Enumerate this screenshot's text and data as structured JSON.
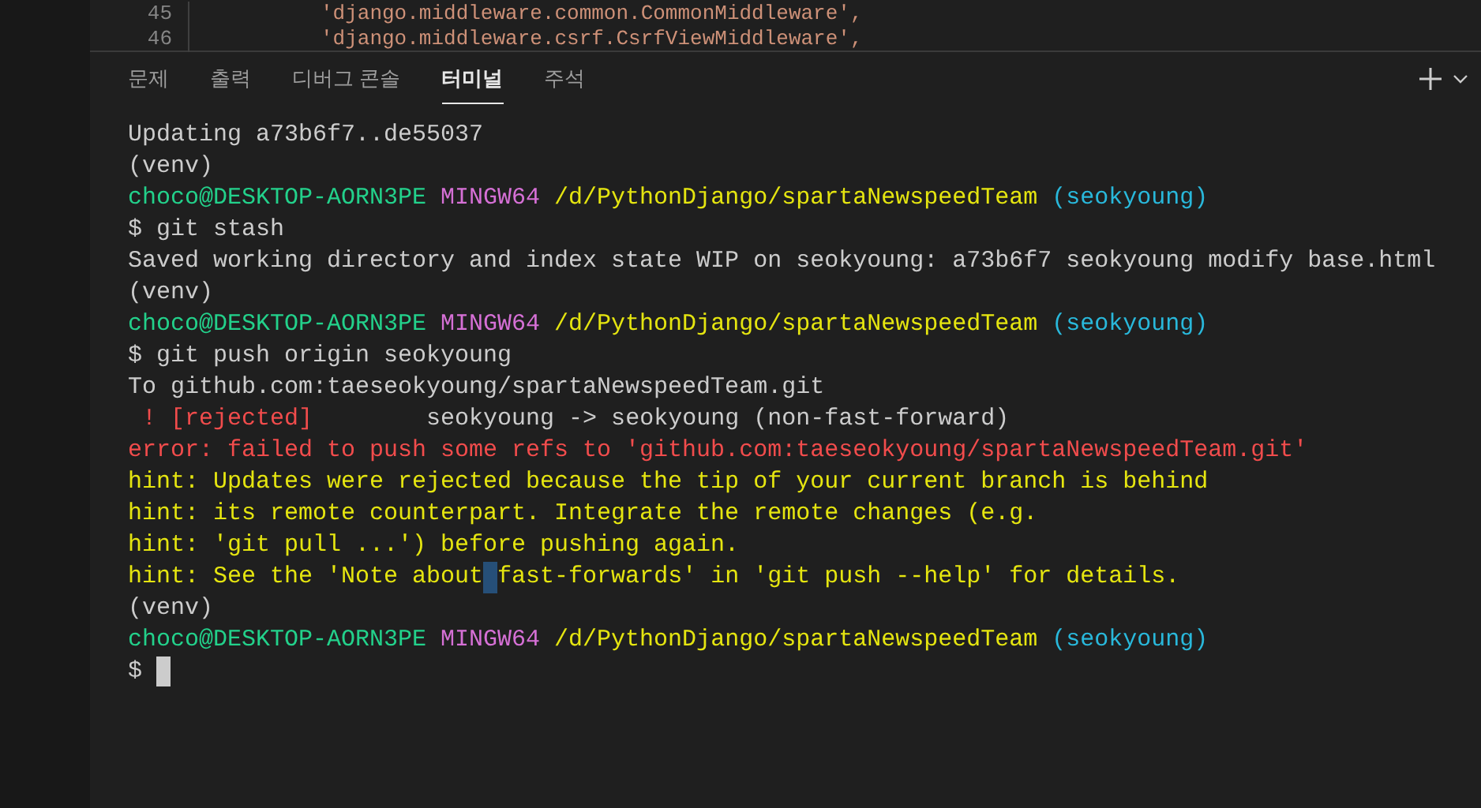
{
  "editor": {
    "lines": [
      {
        "number": "45",
        "code": "'django.middleware.common.CommonMiddleware',"
      },
      {
        "number": "46",
        "code": "'django.middleware.csrf.CsrfViewMiddleware',"
      }
    ]
  },
  "panel": {
    "tabs": [
      {
        "label": "문제",
        "selected": false
      },
      {
        "label": "출력",
        "selected": false
      },
      {
        "label": "디버그 콘솔",
        "selected": false
      },
      {
        "label": "터미널",
        "selected": true
      },
      {
        "label": "주석",
        "selected": false
      }
    ]
  },
  "terminal": {
    "lines": [
      {
        "kind": "output",
        "segments": [
          {
            "text": "Updating a73b6f7..de55037",
            "kind": "plain"
          }
        ]
      },
      {
        "kind": "output",
        "segments": [
          {
            "text": "(venv)",
            "kind": "plain"
          }
        ]
      },
      {
        "kind": "prompt",
        "segments": [
          {
            "text": "choco@DESKTOP-AORN3PE",
            "kind": "user"
          },
          {
            "text": "MINGW64",
            "kind": "system"
          },
          {
            "text": "/d/PythonDjango/spartaNewspeedTeam",
            "kind": "path"
          },
          {
            "text": "(seokyoung)",
            "kind": "branch"
          }
        ]
      },
      {
        "kind": "output",
        "segments": [
          {
            "text": "$ git stash",
            "kind": "plain"
          }
        ]
      },
      {
        "kind": "output",
        "segments": [
          {
            "text": "Saved working directory and index state WIP on seokyoung: a73b6f7 seokyoung modify base.html",
            "kind": "plain"
          }
        ]
      },
      {
        "kind": "output",
        "segments": [
          {
            "text": "(venv)",
            "kind": "plain"
          }
        ]
      },
      {
        "kind": "prompt",
        "segments": [
          {
            "text": "choco@DESKTOP-AORN3PE",
            "kind": "user"
          },
          {
            "text": "MINGW64",
            "kind": "system"
          },
          {
            "text": "/d/PythonDjango/spartaNewspeedTeam",
            "kind": "path"
          },
          {
            "text": "(seokyoung)",
            "kind": "branch"
          }
        ]
      },
      {
        "kind": "output",
        "segments": [
          {
            "text": "$ git push origin seokyoung",
            "kind": "plain"
          }
        ]
      },
      {
        "kind": "output",
        "segments": [
          {
            "text": "To github.com:taeseokyoung/spartaNewspeedTeam.git",
            "kind": "plain"
          }
        ]
      },
      {
        "kind": "output",
        "segments": [
          {
            "text": " ! [rejected]",
            "kind": "error"
          },
          {
            "text": "        seokyoung -> seokyoung (non-fast-forward)",
            "kind": "plain"
          }
        ]
      },
      {
        "kind": "output",
        "segments": [
          {
            "text": "error: failed to push some refs to 'github.com:taeseokyoung/spartaNewspeedTeam.git'",
            "kind": "error"
          }
        ]
      },
      {
        "kind": "output",
        "segments": [
          {
            "text": "hint: Updates were rejected because the tip of your current branch is behind",
            "kind": "hint"
          }
        ]
      },
      {
        "kind": "output",
        "segments": [
          {
            "text": "hint: its remote counterpart. Integrate the remote changes (e.g.",
            "kind": "hint"
          }
        ]
      },
      {
        "kind": "output",
        "segments": [
          {
            "text": "hint: 'git pull ...') before pushing again.",
            "kind": "hint"
          }
        ]
      },
      {
        "kind": "output",
        "segments": [
          {
            "text": "hint: See the 'Note about",
            "kind": "hint"
          },
          {
            "kind": "selection"
          },
          {
            "text": "fast-forwards' in 'git push --help' for details.",
            "kind": "hint"
          }
        ]
      },
      {
        "kind": "output",
        "segments": [
          {
            "text": "(venv)",
            "kind": "plain"
          }
        ]
      },
      {
        "kind": "prompt",
        "segments": [
          {
            "text": "choco@DESKTOP-AORN3PE",
            "kind": "user"
          },
          {
            "text": "MINGW64",
            "kind": "system"
          },
          {
            "text": "/d/PythonDjango/spartaNewspeedTeam",
            "kind": "path"
          },
          {
            "text": "(seokyoung)",
            "kind": "branch"
          }
        ]
      },
      {
        "kind": "prompt",
        "segments": [
          {
            "text": "$",
            "kind": "plain"
          },
          {
            "kind": "cursor"
          }
        ]
      }
    ]
  }
}
